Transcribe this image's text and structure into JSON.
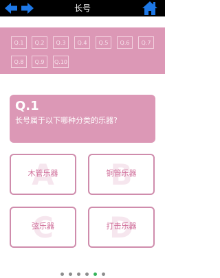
{
  "header": {
    "title": "长号",
    "back_icon": "arrow-left-icon",
    "forward_icon": "arrow-right-icon",
    "home_icon": "home-icon",
    "icon_color": "#1e78e6"
  },
  "question_nav": {
    "items": [
      "Q.1",
      "Q.2",
      "Q.3",
      "Q.4",
      "Q.5",
      "Q.6",
      "Q.7",
      "Q.8",
      "Q.9",
      "Q.10"
    ]
  },
  "question": {
    "number": "Q.1",
    "text": "长号属于以下哪种分类的乐器?"
  },
  "answers": [
    {
      "letter": "A",
      "label": "木管乐器"
    },
    {
      "letter": "B",
      "label": "铜管乐器"
    },
    {
      "letter": "C",
      "label": "弦乐器"
    },
    {
      "letter": "D",
      "label": "打击乐器"
    }
  ],
  "pager": {
    "count": 6,
    "active_index": 4
  },
  "colors": {
    "accent": "#dc98b6",
    "answer_border": "#cf8cac",
    "answer_text": "#cf6c98",
    "active_dot": "#34b45a"
  }
}
